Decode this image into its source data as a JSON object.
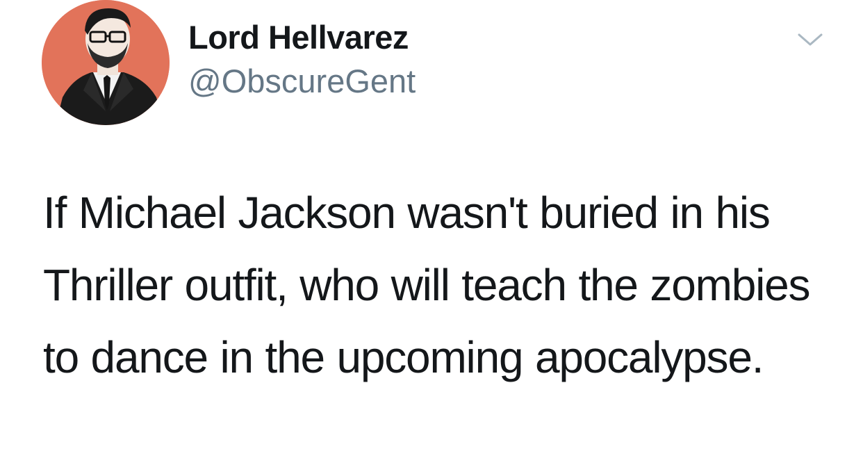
{
  "tweet": {
    "author": {
      "display_name": "Lord Hellvarez",
      "handle": "@ObscureGent",
      "avatar_icon": "illustrated-man-portrait",
      "avatar_bg": "#e2735a"
    },
    "menu_icon": "chevron-down-icon",
    "text": "If Michael Jackson wasn't buried in his Thriller outfit, who will teach the zombies to dance in the upcoming apocalypse."
  },
  "colors": {
    "text_primary": "#14171a",
    "text_secondary": "#657786",
    "caret": "#aab8c2"
  }
}
